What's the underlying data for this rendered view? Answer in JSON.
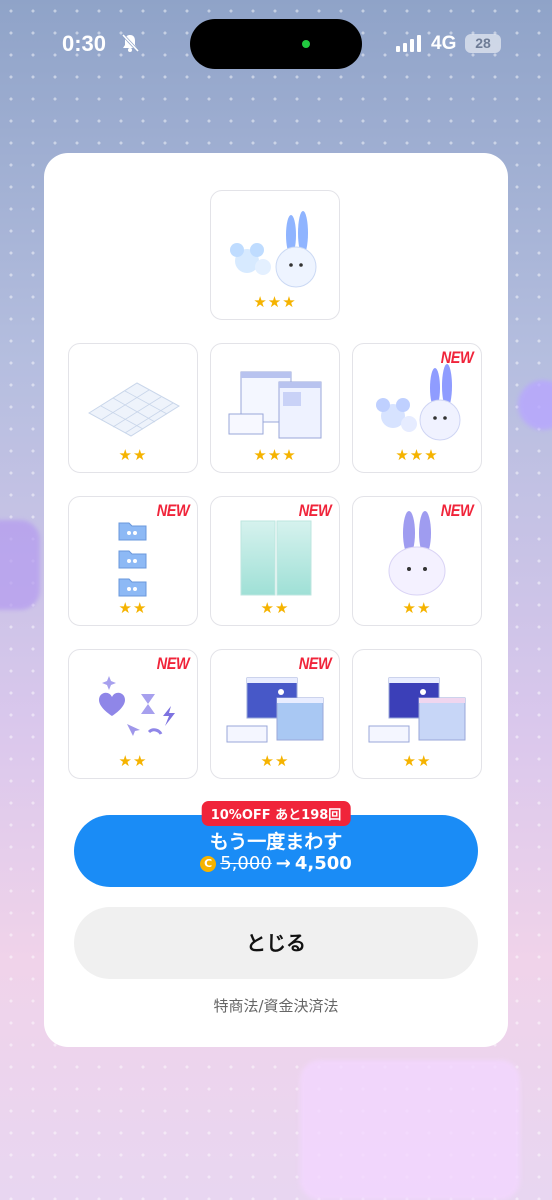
{
  "status_bar": {
    "time": "0:30",
    "network": "4G",
    "battery": "28"
  },
  "gacha": {
    "items": [
      {
        "stars": "★★★",
        "new": "",
        "icon": "mouse-and-bunny-icon"
      },
      {
        "stars": "★★",
        "new": "",
        "icon": "grid-floor-icon"
      },
      {
        "stars": "★★★",
        "new": "",
        "icon": "windows-set-icon"
      },
      {
        "stars": "★★★",
        "new": "NEW",
        "icon": "mouse-and-bunny-icon"
      },
      {
        "stars": "★★",
        "new": "NEW",
        "icon": "folders-icon"
      },
      {
        "stars": "★★",
        "new": "NEW",
        "icon": "glass-panels-icon"
      },
      {
        "stars": "★★",
        "new": "NEW",
        "icon": "bunny-ghost-icon"
      },
      {
        "stars": "★★",
        "new": "NEW",
        "icon": "sticker-set-icon"
      },
      {
        "stars": "★★",
        "new": "NEW",
        "icon": "night-windows-icon"
      },
      {
        "stars": "★★",
        "new": "",
        "icon": "night-windows-icon"
      }
    ]
  },
  "spin": {
    "discount_badge": "10%OFF あと198回",
    "label": "もう一度まわす",
    "coin_symbol": "C",
    "old_price": "5,000",
    "arrow": "→",
    "new_price": "4,500"
  },
  "close_label": "とじる",
  "legal_link": "特商法/資金決済法",
  "colors": {
    "accent": "#1a8cf6",
    "badge": "#f0243a",
    "star": "#f5b300"
  }
}
